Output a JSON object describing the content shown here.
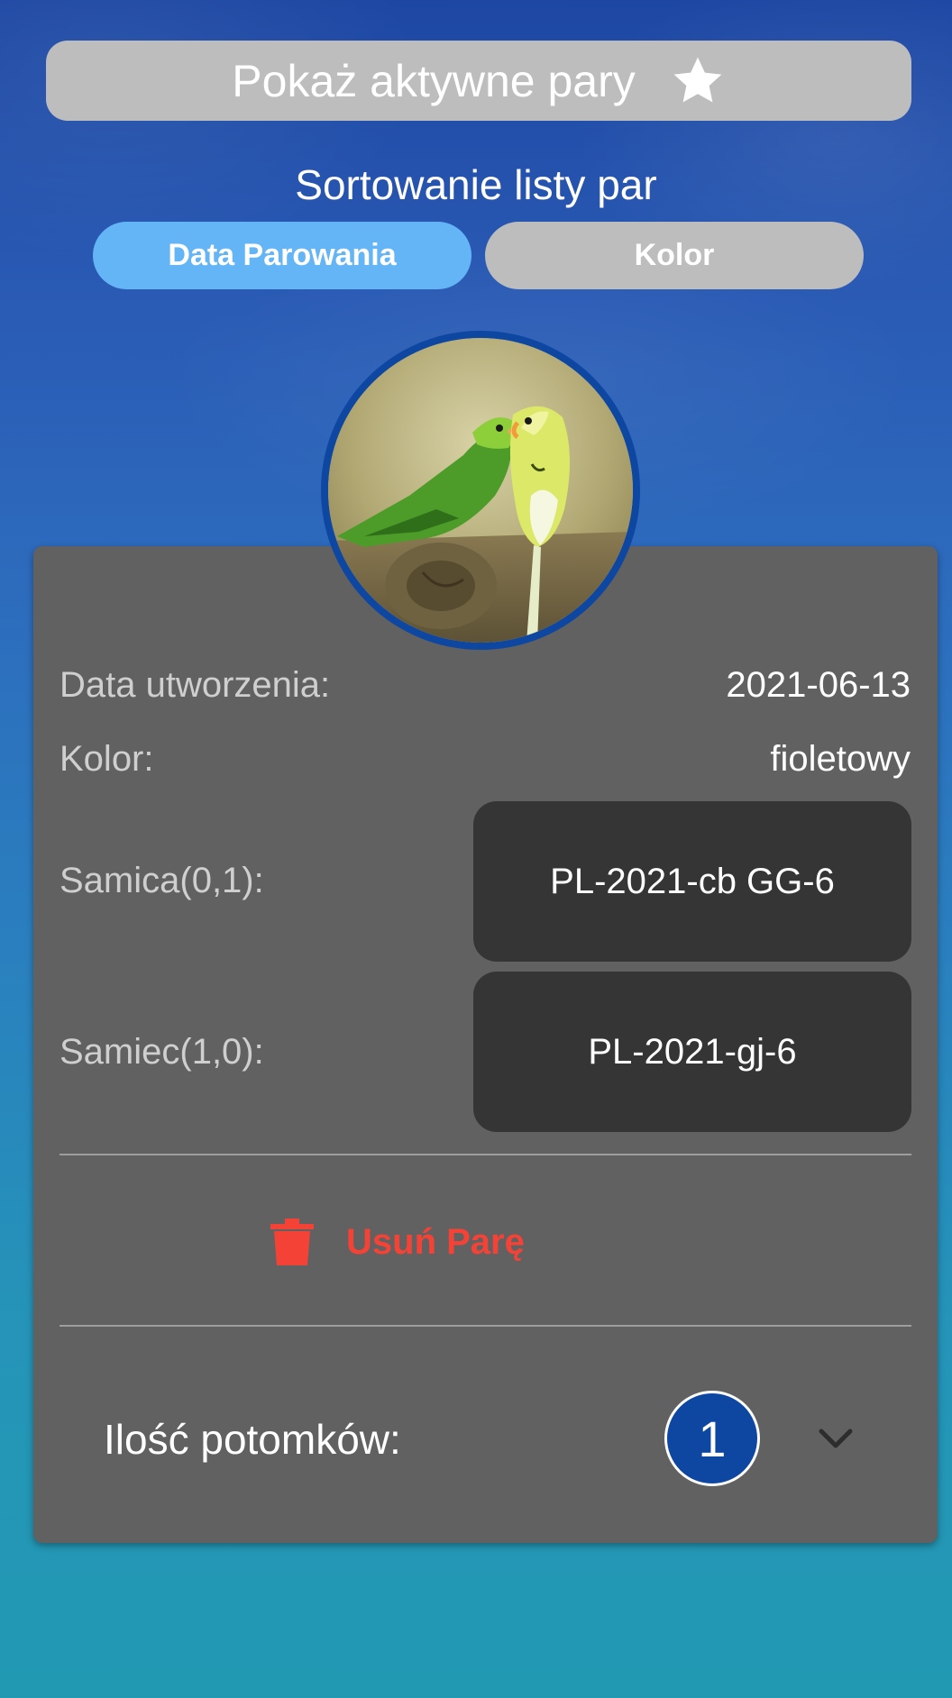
{
  "header": {
    "active_pairs_label": "Pokaż aktywne pary",
    "star_icon": "star-icon"
  },
  "sorting": {
    "title": "Sortowanie listy par",
    "options": [
      {
        "label": "Data Parowania",
        "selected": true
      },
      {
        "label": "Kolor",
        "selected": false
      }
    ]
  },
  "pair_card": {
    "photo": "budgie-pair-photo",
    "created_label": "Data utworzenia:",
    "created_value": "2021-06-13",
    "color_label": "Kolor:",
    "color_value": "fioletowy",
    "female_label": "Samica(0,1):",
    "female_ring": "PL-2021-cb GG-6",
    "male_label": "Samiec(1,0):",
    "male_ring": "PL-2021-gj-6",
    "delete_label": "Usuń Parę",
    "delete_icon": "trash-icon",
    "offspring_label": "Ilość potomków:",
    "offspring_count": "1",
    "expand_icon": "chevron-down-icon"
  },
  "colors": {
    "accent_blue": "#64b5f6",
    "dark_blue": "#0d47a1",
    "card_bg": "#616161",
    "delete_red": "#f44336",
    "button_gray": "#bdbdbd"
  }
}
